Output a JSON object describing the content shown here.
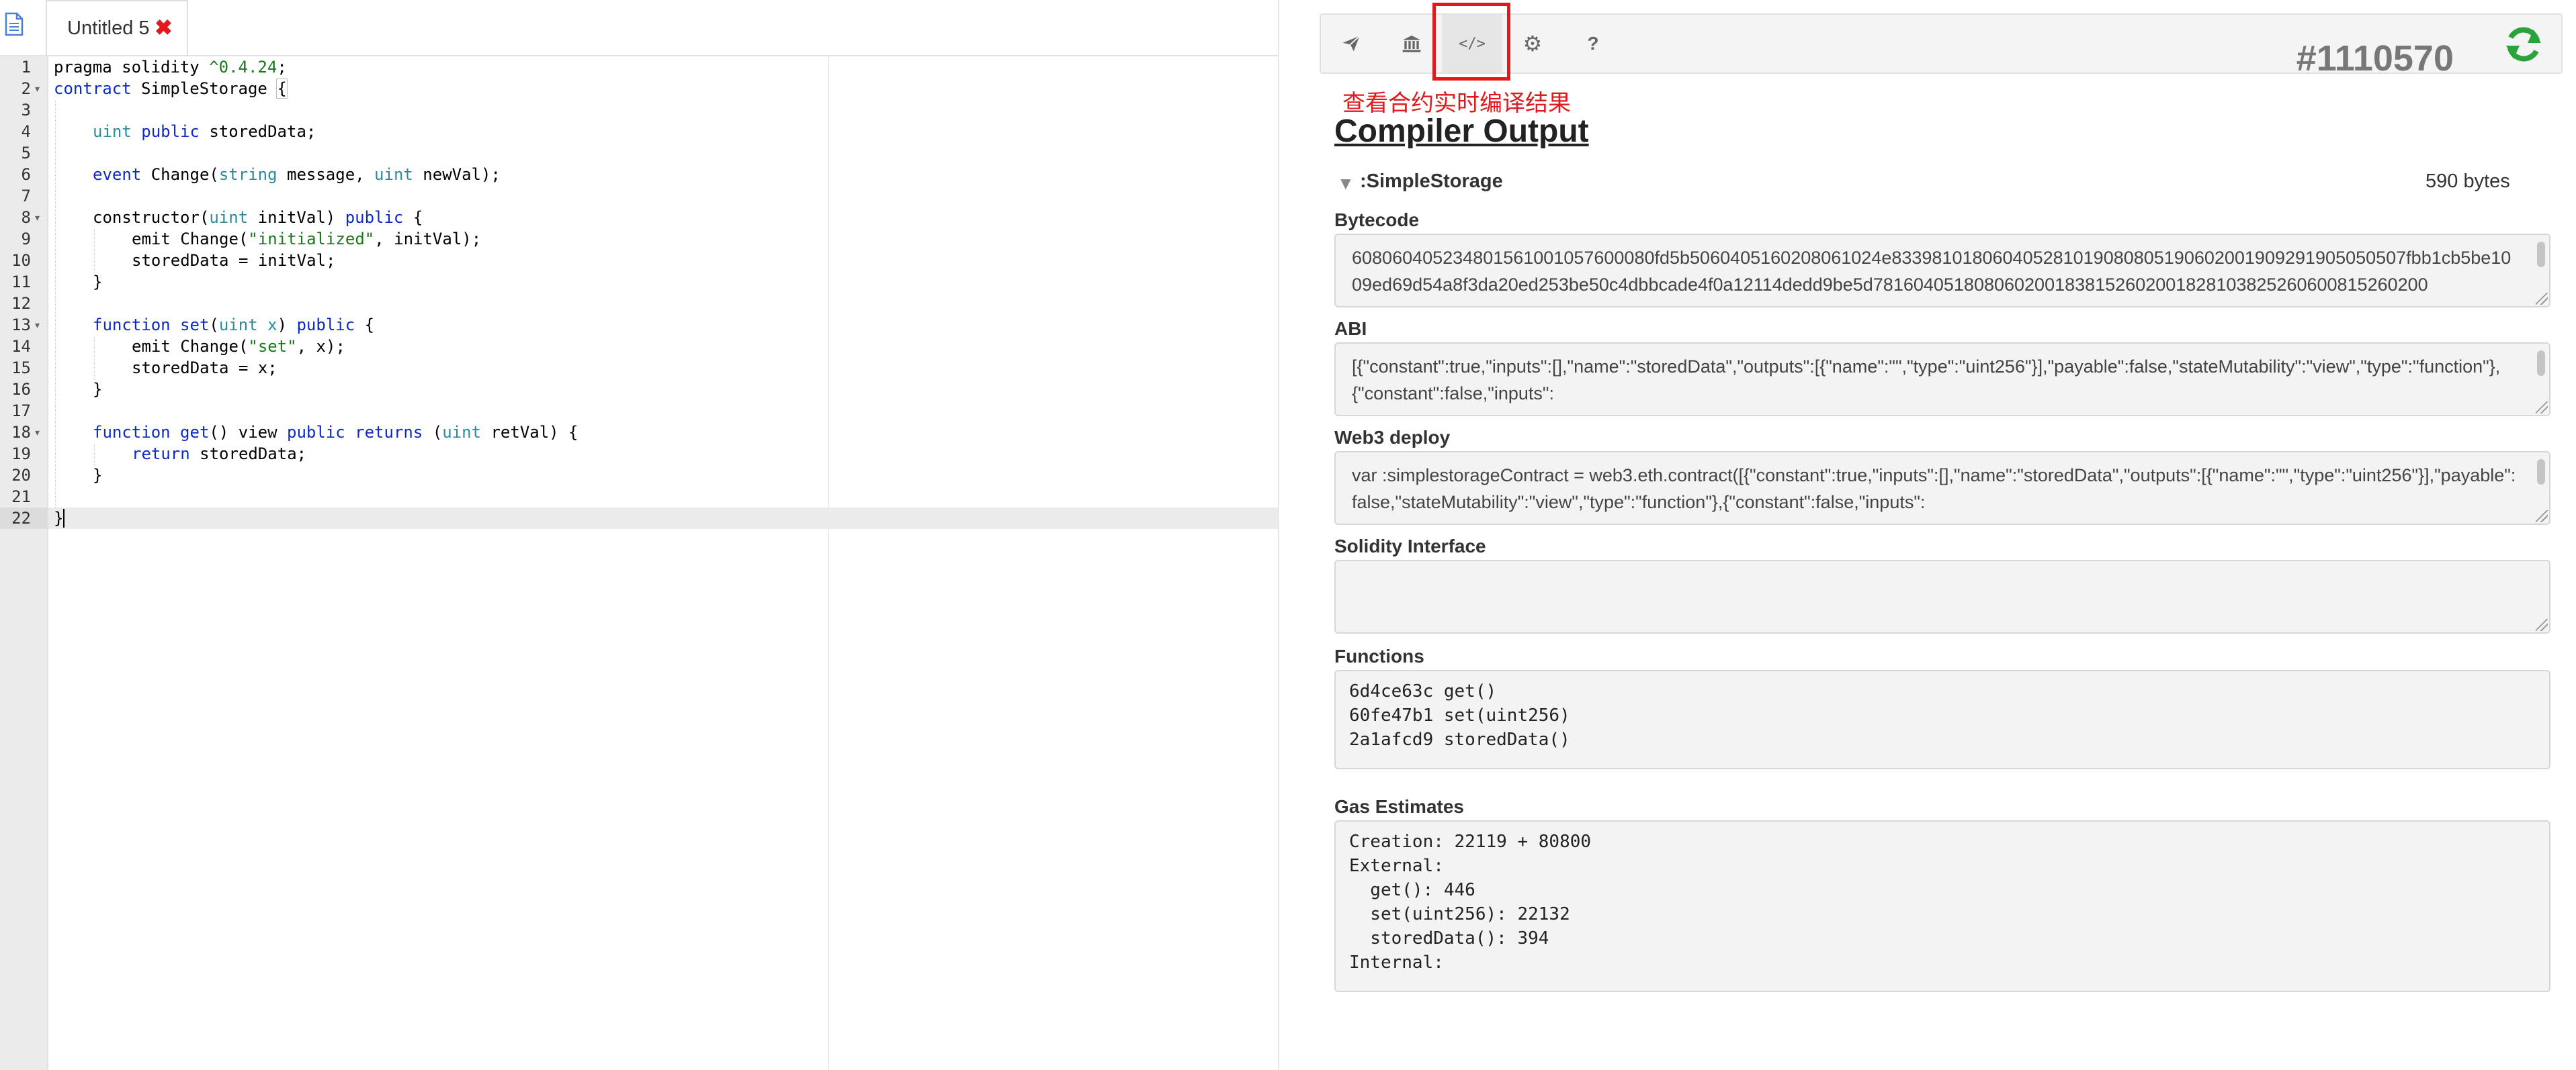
{
  "editor": {
    "tab": {
      "label": "Untitled 5",
      "close_glyph": "✖"
    },
    "line_numbers": [
      "1",
      "2",
      "3",
      "4",
      "5",
      "6",
      "7",
      "8",
      "9",
      "10",
      "11",
      "12",
      "13",
      "14",
      "15",
      "16",
      "17",
      "18",
      "19",
      "20",
      "21",
      "22"
    ],
    "tokens": {
      "l1_a": "pragma solidity ",
      "l1_b": "^0.4.24",
      "l1_c": ";",
      "l2_a": "contract",
      "l2_b": " SimpleStorage ",
      "l2_c": "{",
      "l4_a": "uint",
      "l4_b": " ",
      "l4_c": "public",
      "l4_d": " storedData;",
      "l6_a": "event",
      "l6_b": " Change(",
      "l6_c": "string",
      "l6_d": " message, ",
      "l6_e": "uint",
      "l6_f": " newVal);",
      "l8_a": "constructor(",
      "l8_b": "uint",
      "l8_c": " initVal) ",
      "l8_d": "public",
      "l8_e": " {",
      "l9_a": "emit Change(",
      "l9_b": "\"initialized\"",
      "l9_c": ", initVal);",
      "l10_a": "storedData = initVal;",
      "l11_a": "}",
      "l13_a": "function",
      "l13_b": " ",
      "l13_c": "set",
      "l13_d": "(",
      "l13_e": "uint",
      "l13_f": " ",
      "l13_g": "x",
      "l13_h": ") ",
      "l13_i": "public",
      "l13_j": " {",
      "l14_a": "emit Change(",
      "l14_b": "\"set\"",
      "l14_c": ", x);",
      "l15_a": "storedData = x;",
      "l16_a": "}",
      "l18_a": "function",
      "l18_b": " ",
      "l18_c": "get",
      "l18_d": "() view ",
      "l18_e": "public",
      "l18_f": " ",
      "l18_g": "returns",
      "l18_h": " (",
      "l18_i": "uint",
      "l18_j": " retVal) {",
      "l19_a": "return",
      "l19_b": " storedData;",
      "l20_a": "}",
      "l22_a": "}"
    }
  },
  "toolbar": {
    "icons": [
      "paper-plane-icon",
      "bank-icon",
      "code-icon",
      "gear-icon",
      "question-icon"
    ],
    "code_glyph": "</>",
    "gear_glyph": "⚙",
    "help_glyph": "?",
    "counter": "#1110570",
    "annotation": "查看合约实时编译结果",
    "colors": {
      "annotation": "#e0191d",
      "refresh": "#2aa43a"
    }
  },
  "output": {
    "title": "Compiler Output",
    "contract_arrow": "▼",
    "contract_name": ":SimpleStorage",
    "contract_size": "590 bytes",
    "bytecode_label": "Bytecode",
    "bytecode_text": "608060405234801561001057600080fd5b5060405160208061024e833981018060405281019080805190602001909291905050507fbb1cb5be1009ed69d54a8f3da20ed253be50c4dbbcade4f0a12114dedd9be5d7816040518080602001838152602001828103825260600815260200",
    "abi_label": "ABI",
    "abi_text": "[{\"constant\":true,\"inputs\":[],\"name\":\"storedData\",\"outputs\":[{\"name\":\"\",\"type\":\"uint256\"}],\"payable\":false,\"stateMutability\":\"view\",\"type\":\"function\"},{\"constant\":false,\"inputs\":",
    "web3_label": "Web3 deploy",
    "web3_text": "var :simplestorageContract = web3.eth.contract([{\"constant\":true,\"inputs\":[],\"name\":\"storedData\",\"outputs\":[{\"name\":\"\",\"type\":\"uint256\"}],\"payable\":false,\"stateMutability\":\"view\",\"type\":\"function\"},{\"constant\":false,\"inputs\":",
    "interface_label": "Solidity Interface",
    "interface_text": "",
    "functions_label": "Functions",
    "functions": [
      "6d4ce63c get()",
      "60fe47b1 set(uint256)",
      "2a1afcd9 storedData()"
    ],
    "gas_label": "Gas Estimates",
    "gas_lines": [
      "Creation: 22119 + 80800",
      "External:",
      "  get(): 446",
      "  set(uint256): 22132",
      "  storedData(): 394",
      "Internal:"
    ]
  }
}
